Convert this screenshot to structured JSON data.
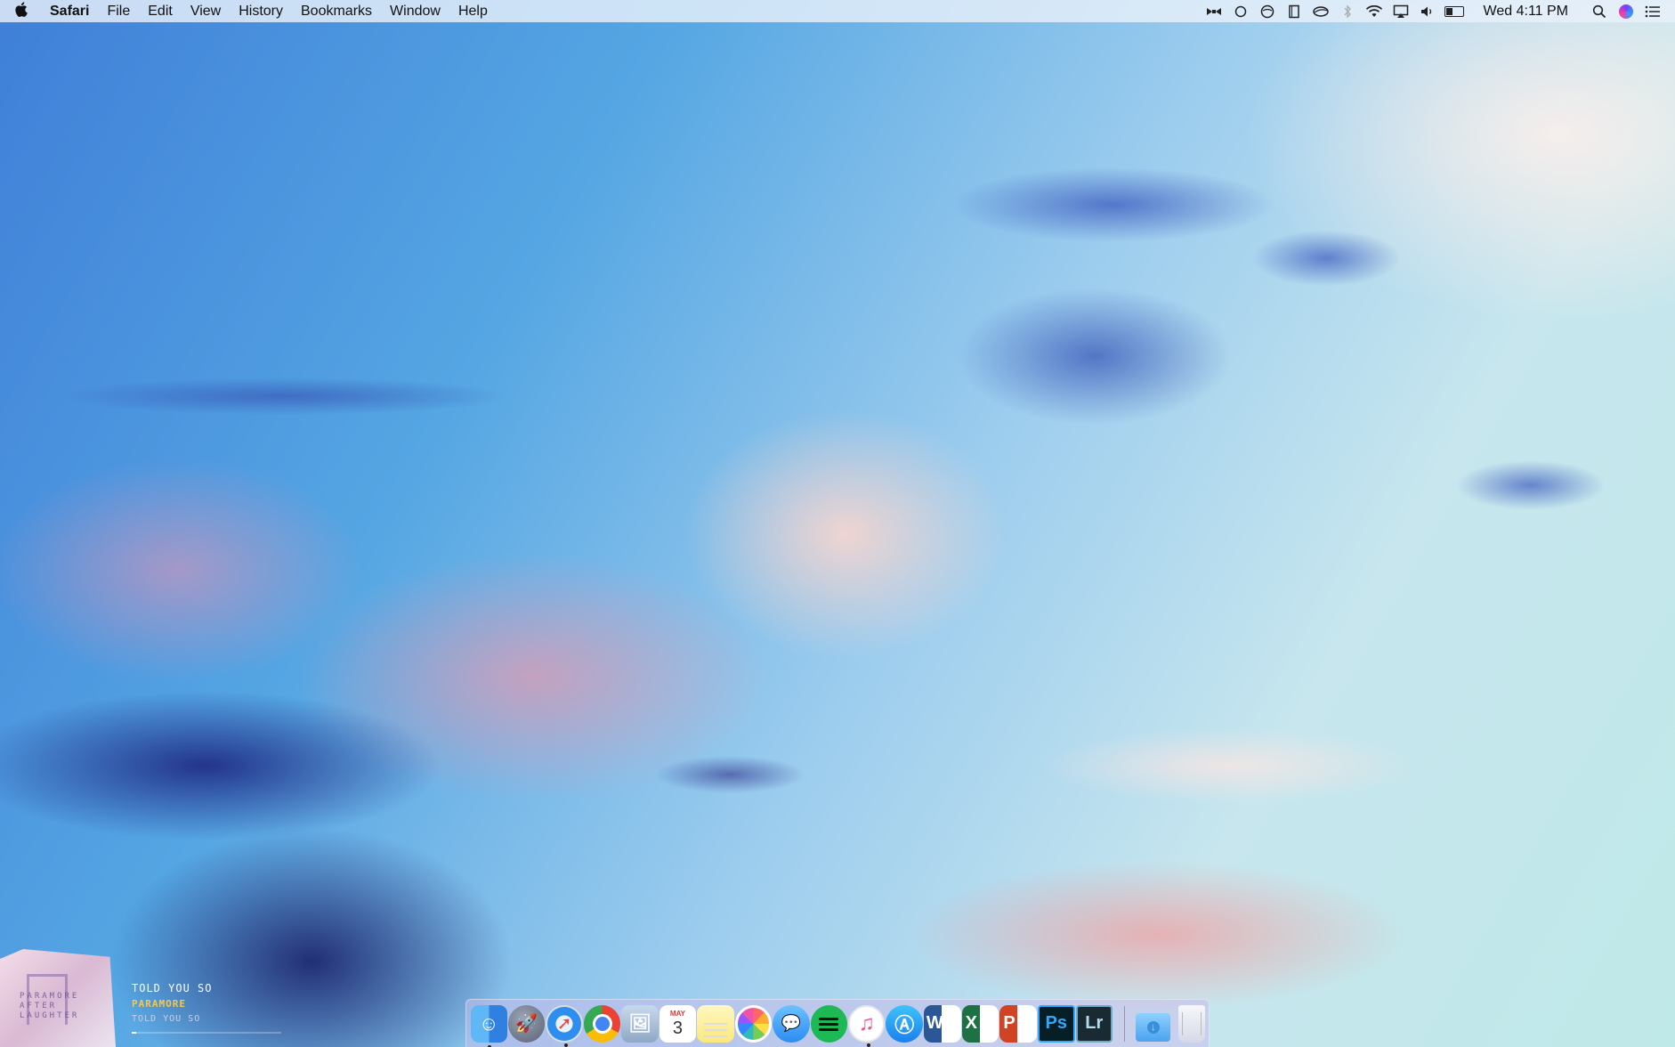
{
  "menubar": {
    "apple_icon": "apple-icon",
    "app_name": "Safari",
    "menus": [
      "File",
      "Edit",
      "View",
      "History",
      "Bookmarks",
      "Window",
      "Help"
    ],
    "status_icons": [
      "bartender-icon",
      "circle-icon",
      "disk-icon",
      "note-icon",
      "cloud-icon",
      "bluetooth-icon",
      "wifi-icon",
      "airplay-icon",
      "volume-icon",
      "battery-icon"
    ],
    "clock": "Wed 4:11 PM",
    "right_icons": [
      "spotlight-search-icon",
      "siri-icon",
      "notification-center-icon"
    ]
  },
  "now_playing": {
    "title": "TOLD YOU SO",
    "artist": "PARAMORE",
    "album": "TOLD YOU SO",
    "album_art_text": "PARAMORE AFTER LAUGHTER",
    "progress": 0.03
  },
  "dock": {
    "apps": [
      {
        "name": "Finder",
        "icon": "finder-icon",
        "running": true
      },
      {
        "name": "Launchpad",
        "icon": "launchpad-icon",
        "running": false
      },
      {
        "name": "Safari",
        "icon": "safari-icon",
        "running": true
      },
      {
        "name": "Chrome",
        "icon": "chrome-icon",
        "running": false
      },
      {
        "name": "Preview",
        "icon": "preview-icon",
        "running": false
      },
      {
        "name": "Calendar",
        "icon": "calendar-icon",
        "running": false,
        "month": "MAY",
        "day": "3"
      },
      {
        "name": "Notes",
        "icon": "notes-icon",
        "running": false
      },
      {
        "name": "Photos",
        "icon": "photos-icon",
        "running": false
      },
      {
        "name": "Messages",
        "icon": "messages-icon",
        "running": false
      },
      {
        "name": "Spotify",
        "icon": "spotify-icon",
        "running": false
      },
      {
        "name": "iTunes",
        "icon": "itunes-icon",
        "running": true
      },
      {
        "name": "App Store",
        "icon": "app-store-icon",
        "running": false
      },
      {
        "name": "Word",
        "icon": "word-icon",
        "running": false,
        "letter": "W"
      },
      {
        "name": "Excel",
        "icon": "excel-icon",
        "running": false,
        "letter": "X"
      },
      {
        "name": "PowerPoint",
        "icon": "powerpoint-icon",
        "running": false,
        "letter": "P"
      },
      {
        "name": "Photoshop",
        "icon": "photoshop-icon",
        "running": false,
        "letter": "Ps"
      },
      {
        "name": "Lightroom",
        "icon": "lightroom-icon",
        "running": false,
        "letter": "Lr"
      }
    ],
    "extras": [
      {
        "name": "Downloads",
        "icon": "downloads-folder-icon"
      },
      {
        "name": "Trash",
        "icon": "trash-icon"
      }
    ]
  },
  "colors": {
    "sky_blue": "#3f7fd8",
    "sky_pink": "#f0a0b4",
    "artist_yellow": "#f2c94c",
    "dock_tint": "#c8beeb"
  }
}
